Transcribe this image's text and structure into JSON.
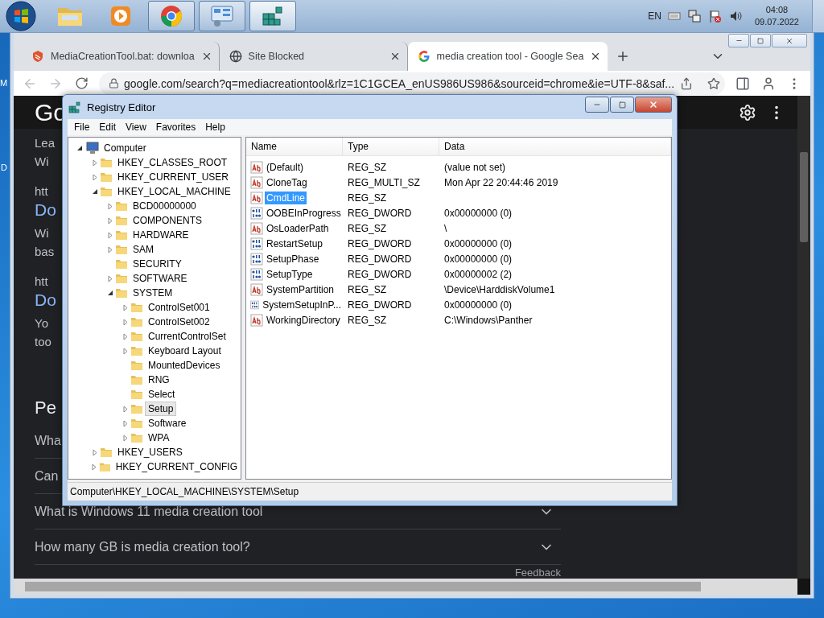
{
  "desktop": {
    "labels": [
      "M",
      "D"
    ]
  },
  "taskbar": {
    "items": [
      {
        "kind": "folder",
        "running": false,
        "selected": false
      },
      {
        "kind": "player",
        "running": false,
        "selected": false
      },
      {
        "kind": "chrome",
        "running": true,
        "selected": false
      },
      {
        "kind": "panel",
        "running": true,
        "selected": false
      },
      {
        "kind": "cubes",
        "running": true,
        "selected": true
      }
    ],
    "tray": {
      "language": "EN",
      "time": "04:08",
      "date": "09.07.2022"
    }
  },
  "browser": {
    "tabs": [
      {
        "kind": "bat",
        "title": "MediaCreationTool.bat: downloa",
        "selected": false
      },
      {
        "kind": "globe",
        "title": "Site Blocked",
        "selected": false
      },
      {
        "kind": "google",
        "title": "media creation tool - Google Sea",
        "selected": true
      }
    ],
    "url": "google.com/search?q=mediacreationtool&rlz=1C1GCEA_enUS986US986&sourceid=chrome&ie=UTF-8&saf...",
    "page": {
      "logo": "Go",
      "fragments": [
        {
          "kind": "text",
          "text": "Lea"
        },
        {
          "kind": "text",
          "text": "Wi"
        },
        {
          "kind": "gap"
        },
        {
          "kind": "url",
          "text": "htt"
        },
        {
          "kind": "link",
          "text": "Do"
        },
        {
          "kind": "text",
          "text": "Wi"
        },
        {
          "kind": "text",
          "text": "bas"
        },
        {
          "kind": "gap"
        },
        {
          "kind": "url",
          "text": "htt"
        },
        {
          "kind": "link",
          "text": "Do"
        },
        {
          "kind": "text",
          "text": "Yo"
        },
        {
          "kind": "text",
          "text": "too"
        }
      ],
      "people_heading": "Pe",
      "questions": [
        {
          "text": "Wha"
        },
        {
          "text": "Can"
        },
        {
          "text": "What is Windows 11 media creation tool"
        },
        {
          "text": "How many GB is media creation tool?"
        }
      ],
      "feedback": "Feedback"
    }
  },
  "regedit": {
    "title": "Registry Editor",
    "menu": [
      "File",
      "Edit",
      "View",
      "Favorites",
      "Help"
    ],
    "tree": [
      {
        "label": "Computer",
        "kind": "computer",
        "expanded": true,
        "selected": false,
        "children": [
          {
            "label": "HKEY_CLASSES_ROOT",
            "kind": "folder",
            "expanded": false,
            "selected": false
          },
          {
            "label": "HKEY_CURRENT_USER",
            "kind": "folder",
            "expanded": false,
            "selected": false
          },
          {
            "label": "HKEY_LOCAL_MACHINE",
            "kind": "folder",
            "expanded": true,
            "selected": false,
            "children": [
              {
                "label": "BCD00000000",
                "kind": "folder",
                "expanded": false,
                "selected": false
              },
              {
                "label": "COMPONENTS",
                "kind": "folder",
                "expanded": false,
                "selected": false
              },
              {
                "label": "HARDWARE",
                "kind": "folder",
                "expanded": false,
                "selected": false
              },
              {
                "label": "SAM",
                "kind": "folder",
                "expanded": false,
                "selected": false
              },
              {
                "label": "SECURITY",
                "kind": "folder",
                "selected": false
              },
              {
                "label": "SOFTWARE",
                "kind": "folder",
                "expanded": false,
                "selected": false
              },
              {
                "label": "SYSTEM",
                "kind": "folder",
                "expanded": true,
                "selected": false,
                "children": [
                  {
                    "label": "ControlSet001",
                    "kind": "folder",
                    "expanded": false,
                    "selected": false
                  },
                  {
                    "label": "ControlSet002",
                    "kind": "folder",
                    "expanded": false,
                    "selected": false
                  },
                  {
                    "label": "CurrentControlSet",
                    "kind": "folder",
                    "expanded": false,
                    "selected": false
                  },
                  {
                    "label": "Keyboard Layout",
                    "kind": "folder",
                    "expanded": false,
                    "selected": false
                  },
                  {
                    "label": "MountedDevices",
                    "kind": "folder",
                    "selected": false
                  },
                  {
                    "label": "RNG",
                    "kind": "folder",
                    "selected": false
                  },
                  {
                    "label": "Select",
                    "kind": "folder",
                    "selected": false
                  },
                  {
                    "label": "Setup",
                    "kind": "folder",
                    "expanded": false,
                    "selected": true
                  },
                  {
                    "label": "Software",
                    "kind": "folder",
                    "expanded": false,
                    "selected": false
                  },
                  {
                    "label": "WPA",
                    "kind": "folder",
                    "expanded": false,
                    "selected": false
                  }
                ]
              }
            ]
          },
          {
            "label": "HKEY_USERS",
            "kind": "folder",
            "expanded": false,
            "selected": false
          },
          {
            "label": "HKEY_CURRENT_CONFIG",
            "kind": "folder",
            "expanded": false,
            "selected": false
          }
        ]
      }
    ],
    "columns": [
      "Name",
      "Type",
      "Data"
    ],
    "values": [
      {
        "kind": "string",
        "name": "(Default)",
        "type": "REG_SZ",
        "data": "(value not set)",
        "selected": false
      },
      {
        "kind": "string",
        "name": "CloneTag",
        "type": "REG_MULTI_SZ",
        "data": "Mon Apr 22 20:44:46 2019",
        "selected": false
      },
      {
        "kind": "string",
        "name": "CmdLine",
        "type": "REG_SZ",
        "selected": true
      },
      {
        "kind": "number",
        "name": "OOBEInProgress",
        "type": "REG_DWORD",
        "data": "0x00000000 (0)",
        "selected": false
      },
      {
        "kind": "string",
        "name": "OsLoaderPath",
        "type": "REG_SZ",
        "data": "\\",
        "selected": false
      },
      {
        "kind": "number",
        "name": "RestartSetup",
        "type": "REG_DWORD",
        "data": "0x00000000 (0)",
        "selected": false
      },
      {
        "kind": "number",
        "name": "SetupPhase",
        "type": "REG_DWORD",
        "data": "0x00000000 (0)",
        "selected": false
      },
      {
        "kind": "number",
        "name": "SetupType",
        "type": "REG_DWORD",
        "data": "0x00000002 (2)",
        "selected": false
      },
      {
        "kind": "string",
        "name": "SystemPartition",
        "type": "REG_SZ",
        "data": "\\Device\\HarddiskVolume1",
        "selected": false
      },
      {
        "kind": "number",
        "name": "SystemSetupInP...",
        "type": "REG_DWORD",
        "data": "0x00000000 (0)",
        "selected": false
      },
      {
        "kind": "string",
        "name": "WorkingDirectory",
        "type": "REG_SZ",
        "data": "C:\\Windows\\Panther",
        "selected": false
      }
    ],
    "status": "Computer\\HKEY_LOCAL_MACHINE\\SYSTEM\\Setup"
  }
}
